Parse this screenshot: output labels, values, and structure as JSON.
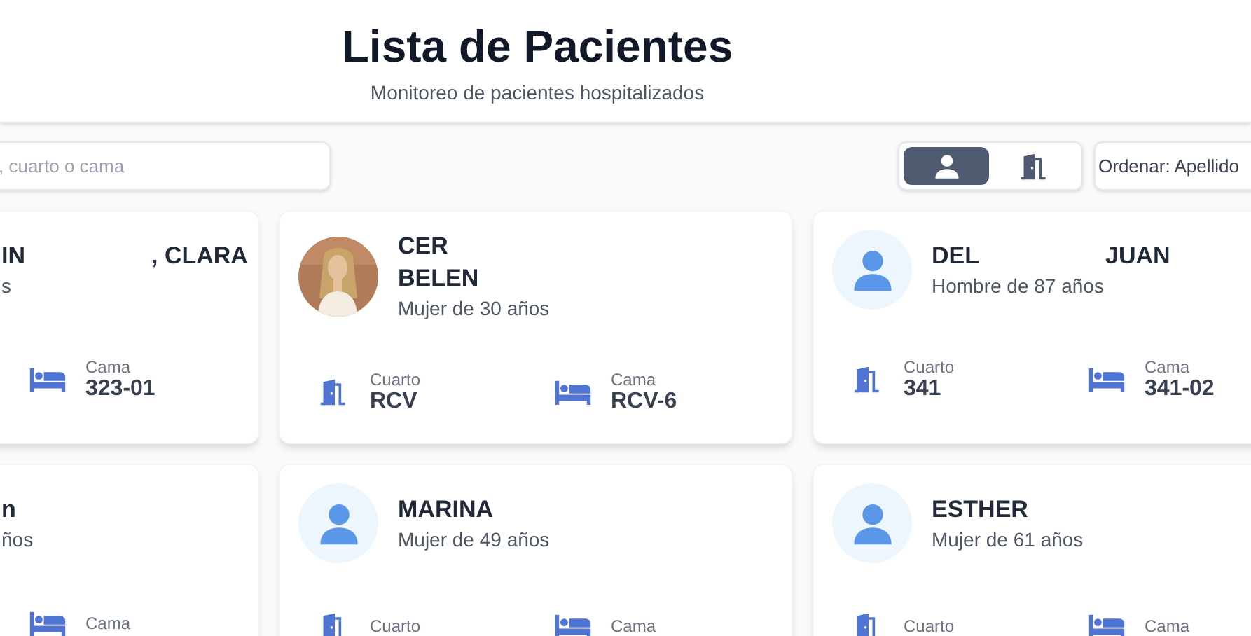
{
  "header": {
    "title": "Lista de Pacientes",
    "subtitle": "Monitoreo de pacientes hospitalizados"
  },
  "search": {
    "placeholder": ", cuarto o cama"
  },
  "view_toggle": [
    {
      "kind": "person",
      "selected": true
    },
    {
      "kind": "room",
      "selected": false
    }
  ],
  "sort": {
    "value": "Ordenar: Apellido"
  },
  "patients": [
    {
      "name_lines": [
        [
          "IN",
          ", CLARA"
        ]
      ],
      "description": "s",
      "bed_label": "Cama",
      "bed": "323-01"
    },
    {
      "kind": "picture",
      "name_lines": [
        [
          "CER"
        ],
        [
          "BELEN"
        ]
      ],
      "description": "Mujer de 30 años",
      "room_label": "Cuarto",
      "room": "RCV",
      "bed_label": "Cama",
      "bed": "RCV-6"
    },
    {
      "kind": "placeholder",
      "name_lines": [
        [
          "DEL",
          "JUAN"
        ]
      ],
      "description": "Hombre de 87 años",
      "room_label": "Cuarto",
      "room": "341",
      "bed_label": "Cama",
      "bed": "341-02"
    },
    {
      "name_lines": [
        [
          "n"
        ]
      ],
      "description": "ños",
      "bed_label": "Cama"
    },
    {
      "kind": "placeholder",
      "name_lines": [
        [
          "MARINA"
        ]
      ],
      "description": "Mujer de 49 años",
      "room_label": "Cuarto",
      "bed_label": "Cama"
    },
    {
      "kind": "placeholder",
      "name_lines": [
        [
          "ESTHER"
        ]
      ],
      "description": "Mujer de 61 años",
      "room_label": "Cuarto",
      "bed_label": "Cama"
    }
  ]
}
